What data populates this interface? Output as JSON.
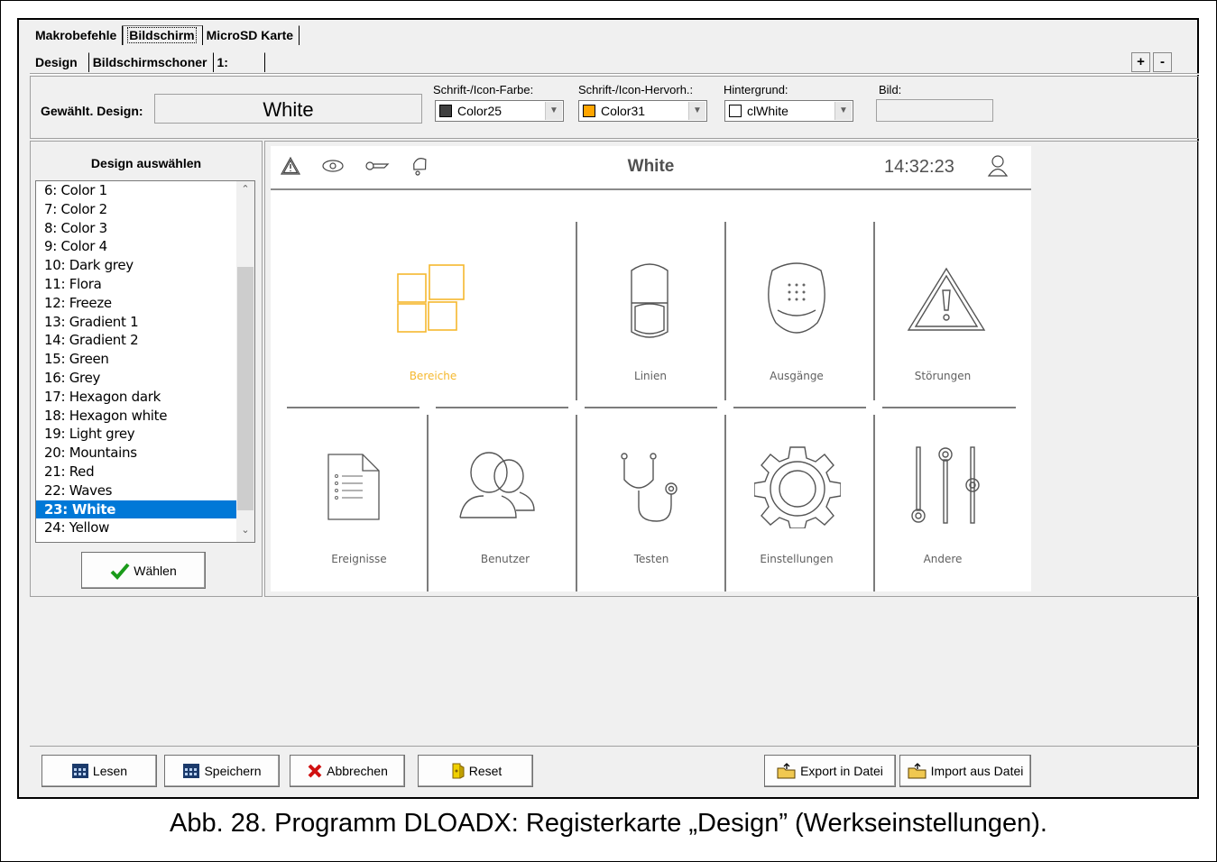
{
  "tabs_main": [
    "Makrobefehle",
    "Bildschirm",
    "MicroSD Karte"
  ],
  "tabs_sub": [
    "Design",
    "Bildschirmschoner",
    "1:"
  ],
  "plus": "+",
  "minus": "-",
  "design": {
    "label": "Gewählt. Design:",
    "value": "White",
    "font_color_label": "Schrift-/Icon-Farbe:",
    "font_color_value": "Color25",
    "font_color_swatch": "#404040",
    "highlight_label": "Schrift-/Icon-Hervorh.:",
    "highlight_value": "Color31",
    "highlight_swatch": "#ffa500",
    "background_label": "Hintergrund:",
    "background_value": "clWhite",
    "background_swatch": "#ffffff",
    "image_label": "Bild:",
    "image_value": ""
  },
  "select": {
    "title": "Design auswählen",
    "items": [
      "6: Color 1",
      "7: Color 2",
      "8: Color 3",
      "9: Color 4",
      "10: Dark grey",
      "11: Flora",
      "12: Freeze",
      "13: Gradient 1",
      "14: Gradient 2",
      "15: Green",
      "16: Grey",
      "17: Hexagon dark",
      "18: Hexagon white",
      "19: Light grey",
      "20: Mountains",
      "21: Red",
      "22: Waves",
      "23: White",
      "24: Yellow"
    ],
    "selected": "23: White",
    "choose_button": "Wählen"
  },
  "preview": {
    "title": "White",
    "time": "14:32:23",
    "accent": "#f5b82e",
    "tiles": [
      "Bereiche",
      "Linien",
      "Ausgänge",
      "Störungen",
      "Ereignisse",
      "Benutzer",
      "Testen",
      "Einstellungen",
      "Andere"
    ]
  },
  "buttons": {
    "read": "Lesen",
    "save": "Speichern",
    "cancel": "Abbrechen",
    "reset": "Reset",
    "export": "Export in Datei",
    "import": "Import aus Datei"
  },
  "caption": "Abb. 28. Programm DLOADX: Registerkarte „Design” (Werkseinstellungen)."
}
